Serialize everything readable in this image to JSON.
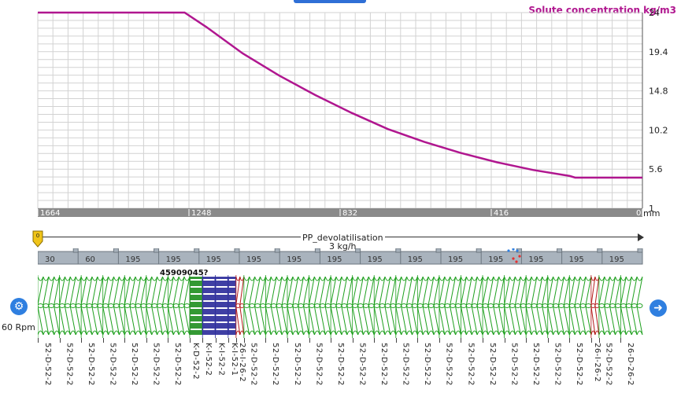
{
  "chart": {
    "title": "Solute concentration kg/m3",
    "y_ticks": [
      "24",
      "19.4",
      "14.8",
      "10.2",
      "5.6",
      "1"
    ],
    "x_ticks": [
      "1664",
      "1248",
      "832",
      "416",
      "0"
    ],
    "x_unit": "mm",
    "line_color": "#b0168f"
  },
  "chart_data": {
    "type": "line",
    "title": "Solute concentration kg/m3",
    "xlabel": "mm",
    "ylabel": "",
    "xlim": [
      1664,
      0
    ],
    "ylim": [
      1,
      24
    ],
    "grid": true,
    "series": [
      {
        "x": [
          1664,
          1300,
          1260,
          1200,
          1100,
          1000,
          900,
          800,
          700,
          600,
          500,
          400,
          300,
          200,
          185,
          100,
          0
        ],
        "y": [
          24,
          24,
          24,
          22.3,
          19.2,
          16.6,
          14.3,
          12.2,
          10.3,
          8.8,
          7.5,
          6.4,
          5.5,
          4.8,
          4.6,
          4.6,
          4.6
        ]
      }
    ]
  },
  "process": {
    "name": "PP_devolatilisation",
    "flow": "3 kg/h"
  },
  "barrel": {
    "segments": [
      "30",
      "60",
      "195",
      "195",
      "195",
      "195",
      "195",
      "195",
      "195",
      "195",
      "195",
      "195",
      "195",
      "195",
      "195"
    ]
  },
  "screw": {
    "element_top_label": "45909045?",
    "speed": "60 Rpm",
    "elements": [
      "52-D-52-2",
      "52-D-52-2",
      "52-D-52-2",
      "52-D-52-2",
      "52-D-52-2",
      "52-D-52-2",
      "52-D-52-2",
      "K-D-52-2",
      "K-I-52-2",
      "K-I-52-2",
      "K-I-52-1",
      "26-I-26-2",
      "52-D-52-2",
      "52-D-52-2",
      "52-D-52-2",
      "52-D-52-2",
      "52-D-52-2",
      "52-D-52-2",
      "52-D-52-2",
      "52-D-52-2",
      "52-D-52-2",
      "52-D-52-2",
      "52-D-52-2",
      "52-D-52-2",
      "52-D-52-2",
      "52-D-52-2",
      "52-D-52-2",
      "52-D-52-2",
      "26-I-26-2",
      "52-D-52-2",
      "26-D-26-2"
    ]
  },
  "colors": {
    "conveying": "#1fa01f",
    "kneading_fwd": "#1e8e1e",
    "kneading_neutral": "#2a2a9a",
    "reverse": "#b51c1c",
    "accent": "#2f7fe0"
  },
  "icons": {
    "settings": "gear-icon",
    "next": "arrow-right-icon",
    "pin": "position-pin-icon"
  }
}
